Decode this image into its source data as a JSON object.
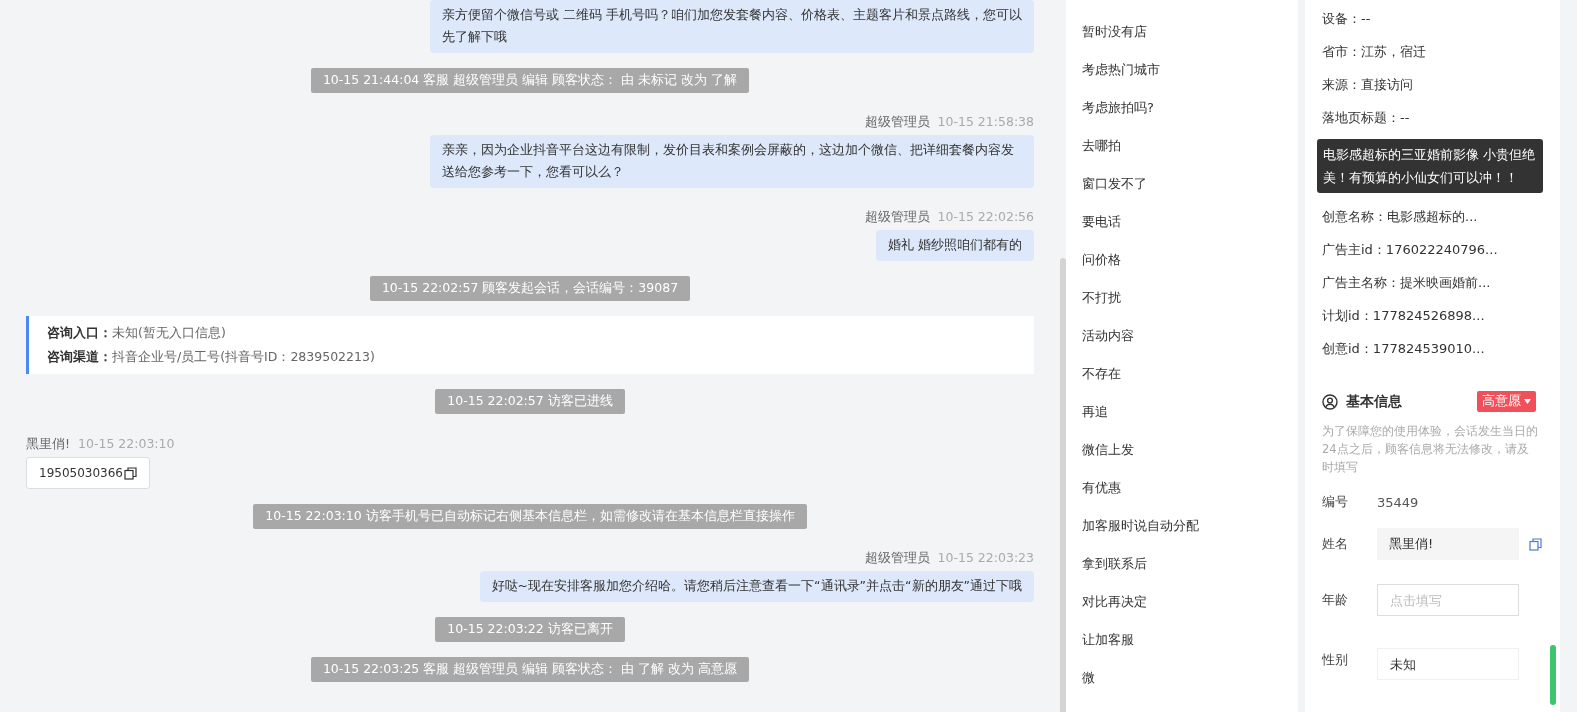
{
  "chat": {
    "messages": [
      {
        "kind": "agent",
        "text": "亲方便留个微信号或 二维码 手机号吗？咱们加您发套餐内容、价格表、主题客片和景点路线，您可以先了解下哦"
      },
      {
        "kind": "system",
        "text": "10-15 21:44:04 客服 超级管理员 编辑 顾客状态： 由 未标记 改为 了解"
      },
      {
        "kind": "agent",
        "sender": "超级管理员",
        "time": "10-15 21:58:38",
        "text": "亲亲，因为企业抖音平台这边有限制，发价目表和案例会屏蔽的，这边加个微信、把详细套餐内容发送给您参考一下，您看可以么？"
      },
      {
        "kind": "agent",
        "sender": "超级管理员",
        "time": "10-15 22:02:56",
        "text": "婚礼 婚纱照咱们都有的"
      },
      {
        "kind": "system",
        "text": "10-15 22:02:57 顾客发起会话，会话编号：39087"
      },
      {
        "kind": "info",
        "lines": [
          {
            "label": "咨询入口：",
            "value": "未知(暂无入口信息)"
          },
          {
            "label": "咨询渠道：",
            "value": "抖音企业号/员工号(抖音号ID：2839502213)"
          }
        ]
      },
      {
        "kind": "system",
        "text": "10-15 22:02:57 访客已进线"
      },
      {
        "kind": "visitor",
        "sender": "黑里俏!",
        "time": "10-15 22:03:10",
        "text": "19505030366"
      },
      {
        "kind": "system",
        "text": "10-15 22:03:10 访客手机号已自动标记右侧基本信息栏，如需修改请在基本信息栏直接操作"
      },
      {
        "kind": "agent",
        "sender": "超级管理员",
        "time": "10-15 22:03:23",
        "text": "好哒~现在安排客服加您介绍哈。请您稍后注意查看一下“通讯录”并点击“新的朋友”通过下哦"
      },
      {
        "kind": "system",
        "text": "10-15 22:03:22 访客已离开"
      },
      {
        "kind": "system",
        "text": "10-15 22:03:25 客服 超级管理员 编辑 顾客状态： 由 了解 改为 高意愿"
      }
    ]
  },
  "quick_replies": [
    "暂时没有店",
    "考虑热门城市",
    "考虑旅拍吗?",
    "去哪拍",
    "窗口发不了",
    "要电话",
    "问价格",
    "不打扰",
    "活动内容",
    "不存在",
    "再追",
    "微信上发",
    "有优惠",
    "加客服时说自动分配",
    "拿到联系后",
    "对比再决定",
    "让加客服",
    "微"
  ],
  "visitor_info": {
    "lines_above": [
      "设备：--",
      "省市：江苏，宿迁",
      "来源：直接访问",
      "落地页标题：--"
    ],
    "tooltip": "电影感超标的三亚婚前影像 小贵但绝美！有预算的小仙女们可以冲！！",
    "lines_below": [
      "创意名称：电影感超标的...",
      "广告主id：176022240796...",
      "广告主名称：提米映画婚前...",
      "计划id：177824526898...",
      "创意id：177824539010..."
    ]
  },
  "basic_info": {
    "title": "基本信息",
    "tag": "高意愿",
    "notice": "为了保障您的使用体验，会话发生当日的24点之后，顾客信息将无法修改，请及时填写",
    "fields": [
      {
        "label": "编号",
        "kind": "text",
        "value": "35449"
      },
      {
        "label": "姓名",
        "kind": "filled",
        "value": "黑里俏!"
      },
      {
        "label": "年龄",
        "kind": "input",
        "placeholder": "点击填写"
      },
      {
        "label": "性别",
        "kind": "select",
        "value": "未知"
      }
    ]
  }
}
